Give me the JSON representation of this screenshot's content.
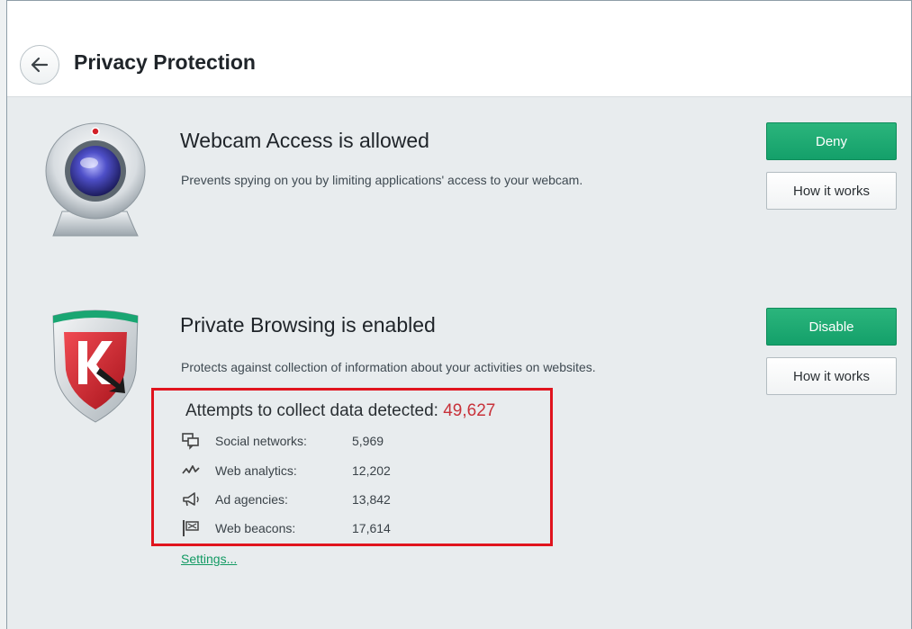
{
  "header": {
    "title": "Privacy Protection",
    "back_icon": "arrow-left-icon"
  },
  "webcam": {
    "icon": "webcam-icon",
    "title": "Webcam Access is allowed",
    "description": "Prevents spying on you by limiting applications' access to your webcam.",
    "primary_button": "Deny",
    "secondary_button": "How it works"
  },
  "browsing": {
    "icon": "kaspersky-shield-icon",
    "title": "Private Browsing is enabled",
    "description": "Protects against collection of information about your activities on websites.",
    "primary_button": "Disable",
    "secondary_button": "How it works",
    "attempts_label": "Attempts to collect data detected:",
    "attempts_total": "49,627",
    "stats": [
      {
        "icon": "social-networks-icon",
        "label": "Social networks:",
        "value": "5,969"
      },
      {
        "icon": "web-analytics-icon",
        "label": "Web analytics:",
        "value": "12,202"
      },
      {
        "icon": "ad-agencies-icon",
        "label": "Ad agencies:",
        "value": "13,842"
      },
      {
        "icon": "web-beacons-icon",
        "label": "Web beacons:",
        "value": "17,614"
      }
    ],
    "settings_link": "Settings..."
  },
  "colors": {
    "accent_green": "#14a06a",
    "highlight_red": "#e0141e",
    "total_red": "#c8323a",
    "link_green": "#129a63"
  }
}
